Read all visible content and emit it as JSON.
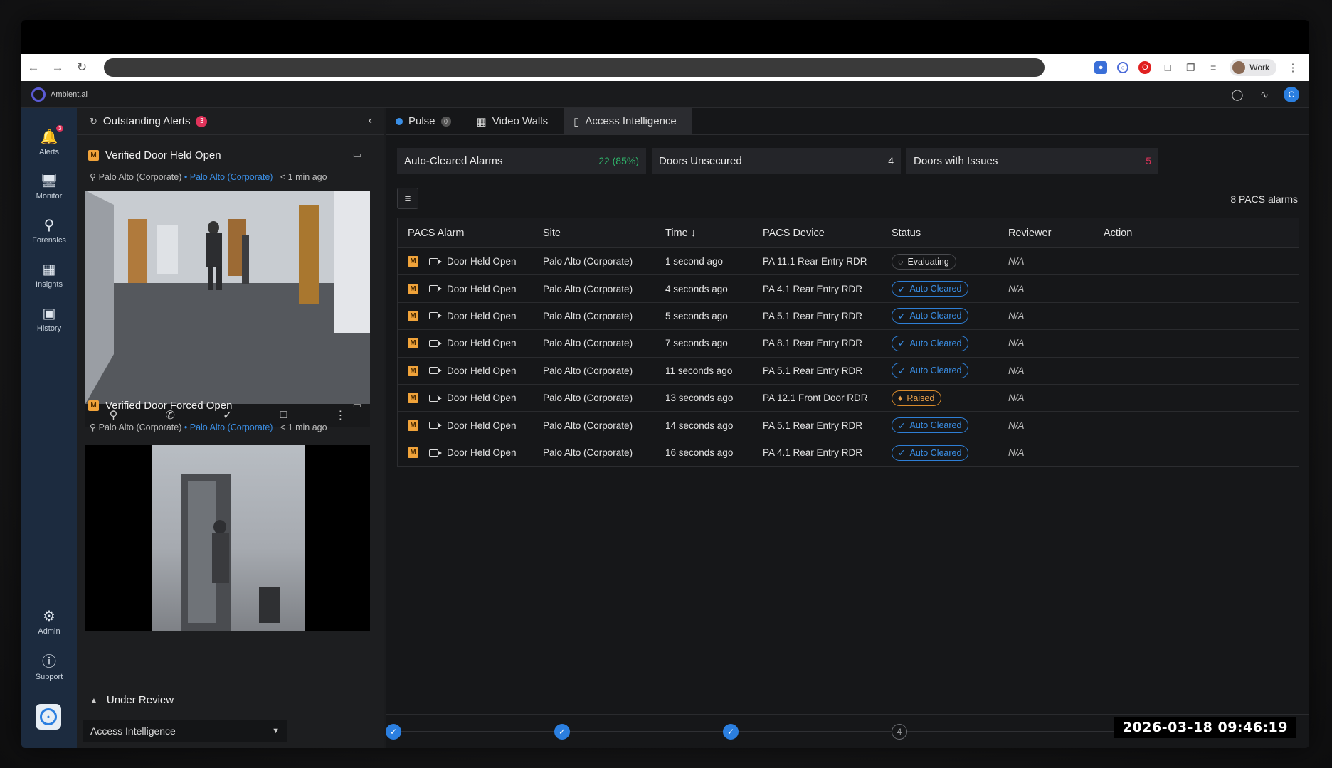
{
  "browser": {
    "profile": "Work"
  },
  "app": {
    "name": "Ambient.ai",
    "user_initial": "C"
  },
  "sidebar": {
    "alerts_badge": "3",
    "items": [
      {
        "label": "Alerts"
      },
      {
        "label": "Monitor"
      },
      {
        "label": "Forensics"
      },
      {
        "label": "Insights"
      },
      {
        "label": "History"
      },
      {
        "label": "Admin"
      },
      {
        "label": "Support"
      }
    ]
  },
  "alerts_panel": {
    "title": "Outstanding Alerts",
    "count": "3",
    "cards": [
      {
        "severity": "M",
        "title": "Verified Door Held Open",
        "site": "Palo Alto (Corporate)",
        "site_link": "Palo Alto (Corporate)",
        "age": "< 1 min ago"
      },
      {
        "severity": "M",
        "title": "Verified Door Forced Open",
        "site": "Palo Alto (Corporate)",
        "site_link": "Palo Alto (Corporate)",
        "age": "< 1 min ago"
      }
    ],
    "under_review": "Under Review",
    "workspace_select": "Access Intelligence"
  },
  "tabs": [
    {
      "label": "Pulse",
      "badge": "0"
    },
    {
      "label": "Video Walls"
    },
    {
      "label": "Access Intelligence"
    }
  ],
  "stats": [
    {
      "label": "Auto-Cleared Alarms",
      "value": "22 (85%)",
      "color": "#2fb36a"
    },
    {
      "label": "Doors Unsecured",
      "value": "4",
      "color": "#e0e0e0"
    },
    {
      "label": "Doors with Issues",
      "value": "5",
      "color": "#e0335a"
    }
  ],
  "table": {
    "count_label": "8 PACS alarms",
    "columns": [
      "PACS Alarm",
      "Site",
      "Time",
      "PACS Device",
      "Status",
      "Reviewer",
      "Action"
    ],
    "rows": [
      {
        "alarm": "Door Held Open",
        "site": "Palo Alto (Corporate)",
        "time": "1 second ago",
        "device": "PA 11.1 Rear Entry RDR",
        "status": "Evaluating",
        "status_type": "eval",
        "reviewer": "N/A"
      },
      {
        "alarm": "Door Held Open",
        "site": "Palo Alto (Corporate)",
        "time": "4 seconds ago",
        "device": "PA 4.1 Rear Entry RDR",
        "status": "Auto Cleared",
        "status_type": "auto",
        "reviewer": "N/A"
      },
      {
        "alarm": "Door Held Open",
        "site": "Palo Alto (Corporate)",
        "time": "5 seconds ago",
        "device": "PA 5.1 Rear Entry RDR",
        "status": "Auto Cleared",
        "status_type": "auto",
        "reviewer": "N/A"
      },
      {
        "alarm": "Door Held Open",
        "site": "Palo Alto (Corporate)",
        "time": "7 seconds ago",
        "device": "PA 8.1 Rear Entry RDR",
        "status": "Auto Cleared",
        "status_type": "auto",
        "reviewer": "N/A"
      },
      {
        "alarm": "Door Held Open",
        "site": "Palo Alto (Corporate)",
        "time": "11 seconds ago",
        "device": "PA 5.1 Rear Entry RDR",
        "status": "Auto Cleared",
        "status_type": "auto",
        "reviewer": "N/A"
      },
      {
        "alarm": "Door Held Open",
        "site": "Palo Alto (Corporate)",
        "time": "13 seconds ago",
        "device": "PA 12.1 Front Door RDR",
        "status": "Raised",
        "status_type": "raised",
        "reviewer": "N/A"
      },
      {
        "alarm": "Door Held Open",
        "site": "Palo Alto (Corporate)",
        "time": "14 seconds ago",
        "device": "PA 5.1 Rear Entry RDR",
        "status": "Auto Cleared",
        "status_type": "auto",
        "reviewer": "N/A"
      },
      {
        "alarm": "Door Held Open",
        "site": "Palo Alto (Corporate)",
        "time": "16 seconds ago",
        "device": "PA 4.1 Rear Entry RDR",
        "status": "Auto Cleared",
        "status_type": "auto",
        "reviewer": "N/A"
      }
    ]
  },
  "steps": {
    "current": "4"
  },
  "timestamp": "2026-03-18 09:46:19"
}
